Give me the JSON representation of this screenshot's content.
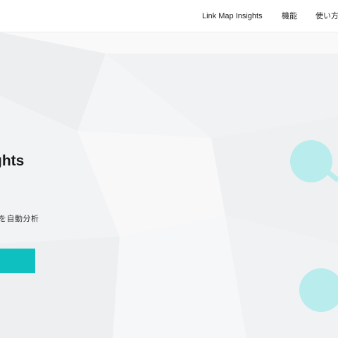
{
  "header": {
    "nav": [
      "Link Map Insights",
      "機能",
      "使い方"
    ]
  },
  "hero": {
    "title": "ghts",
    "subtitle": "を自動分析",
    "cta_label": "",
    "accent_color": "#0ec0c0",
    "node_color": "#b9ecec"
  }
}
